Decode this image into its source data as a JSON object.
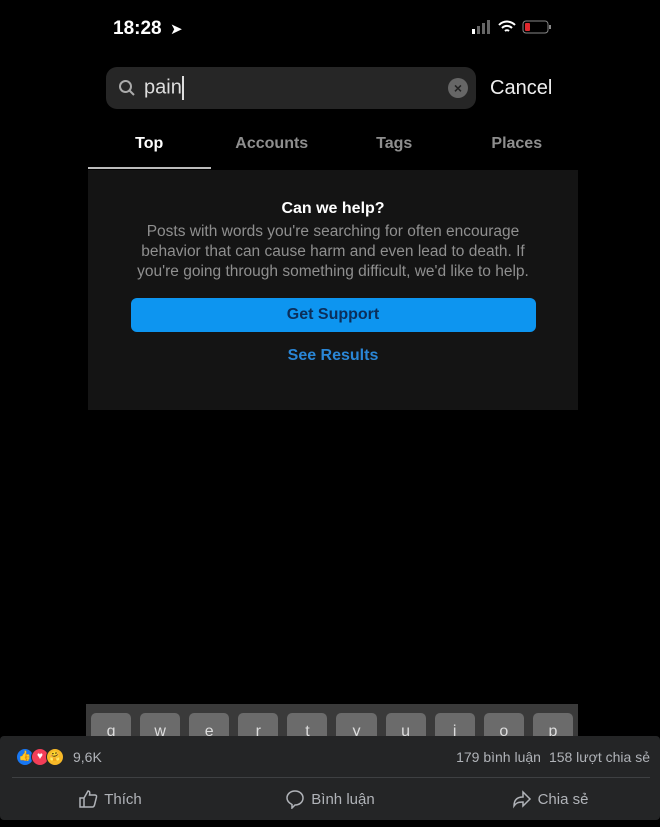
{
  "status_bar": {
    "time": "18:28",
    "battery_color": "#e0282e"
  },
  "search": {
    "value": "pain",
    "cancel_label": "Cancel"
  },
  "tabs": [
    {
      "label": "Top",
      "active": true
    },
    {
      "label": "Accounts"
    },
    {
      "label": "Tags"
    },
    {
      "label": "Places"
    }
  ],
  "help_card": {
    "title": "Can we help?",
    "body": "Posts with words you're searching for often encourage behavior that can cause harm and even lead to death. If you're going through something difficult, we'd like to help.",
    "support_label": "Get Support",
    "results_label": "See Results",
    "accent": "#0d95f0"
  },
  "keyboard": {
    "keys": [
      "q",
      "w",
      "e",
      "r",
      "t",
      "y",
      "u",
      "i",
      "o",
      "p"
    ]
  },
  "facebook": {
    "reaction_count": "9,6K",
    "comments": "179 bình luận",
    "shares": "158 lượt chia sẻ",
    "actions": {
      "like": "Thích",
      "comment": "Bình luận",
      "share": "Chia sẻ"
    }
  }
}
